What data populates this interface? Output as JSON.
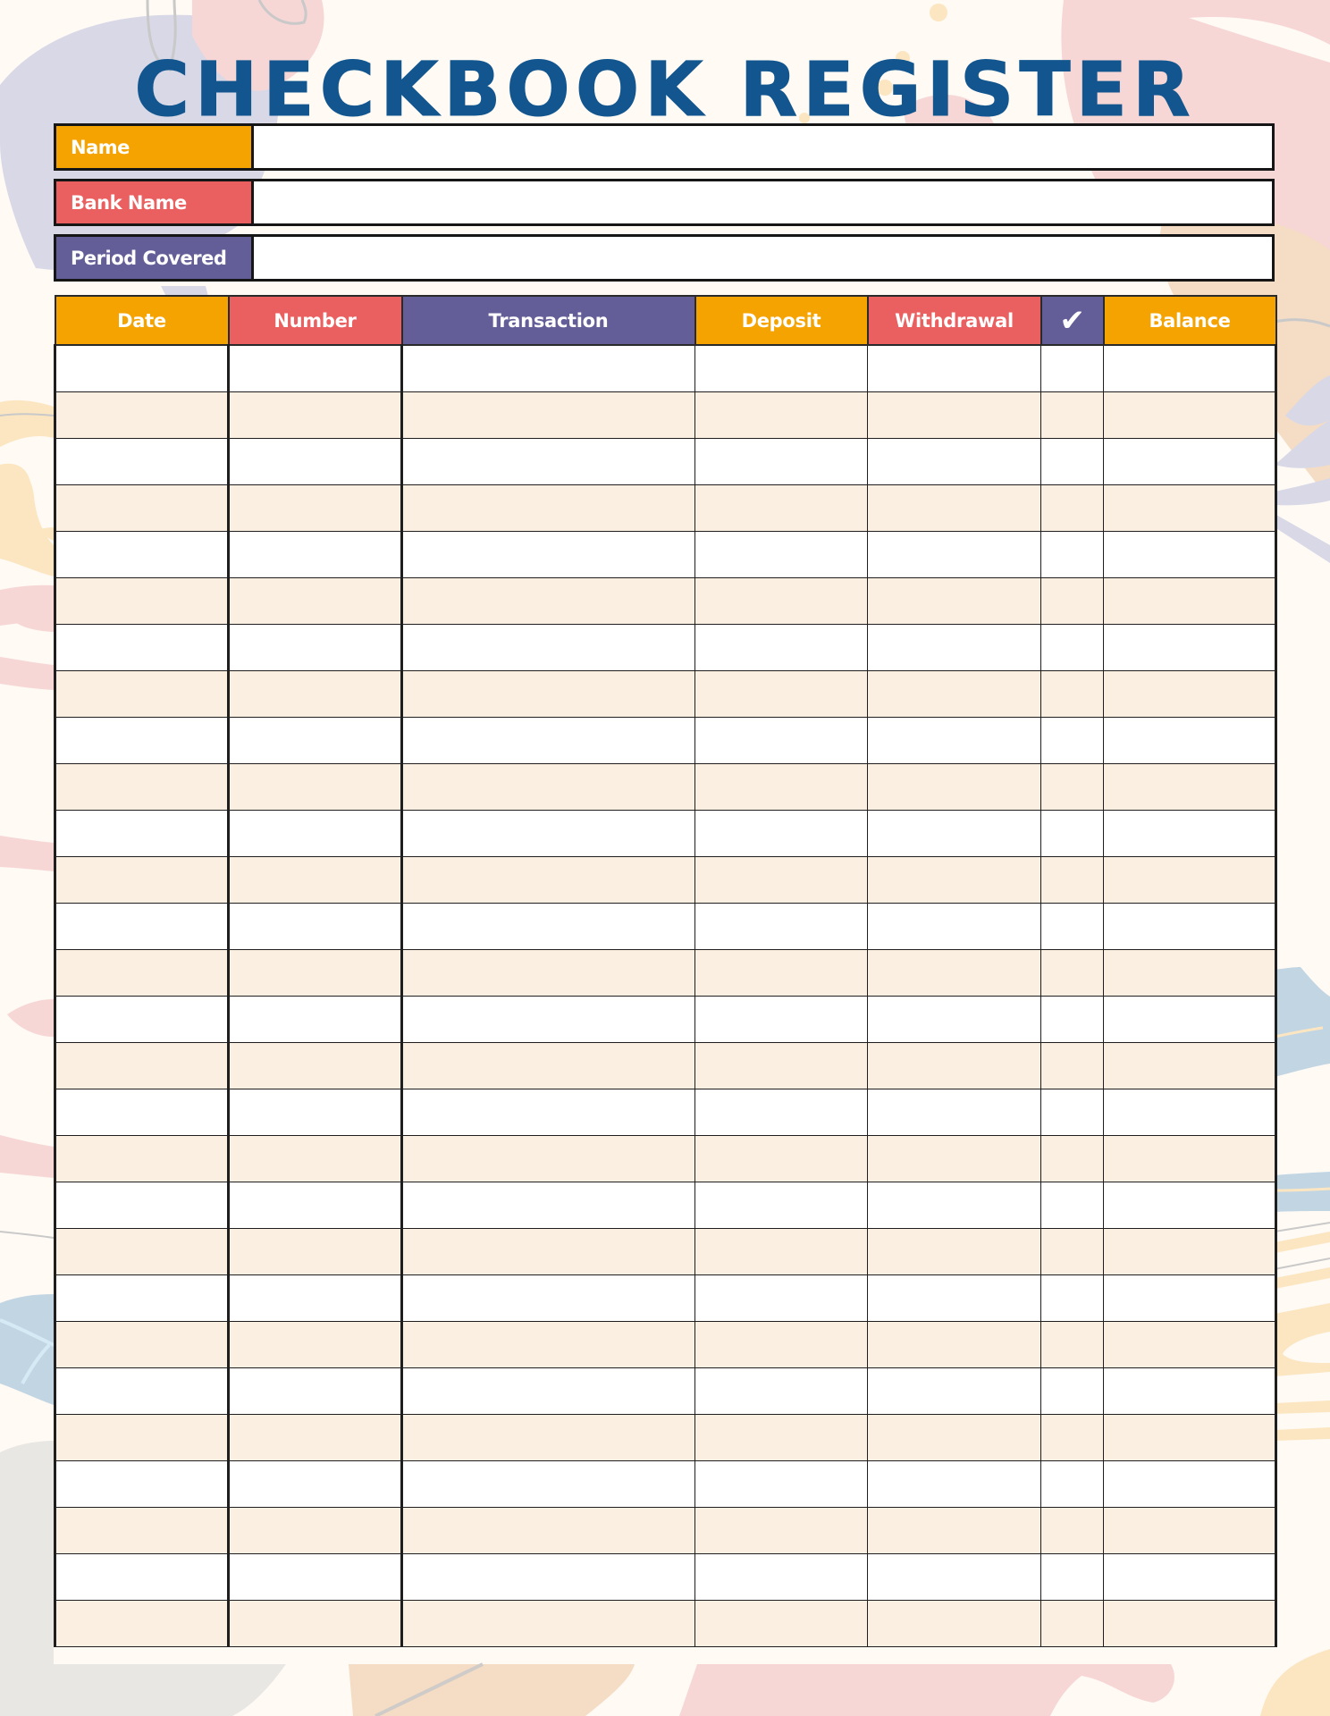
{
  "title": "CHECKBOOK REGISTER",
  "colors": {
    "orange": "#F4A300",
    "coral": "#EA5F5F",
    "purple": "#635E98",
    "title_blue": "#13568F",
    "row_alt": "#FBEFE2",
    "row_plain": "#FFFFFF",
    "page_bg": "#FFFAF4"
  },
  "info_fields": [
    {
      "label": "Name",
      "value": "",
      "color": "#F4A300"
    },
    {
      "label": "Bank Name",
      "value": "",
      "color": "#EA5F5F"
    },
    {
      "label": "Period Covered",
      "value": "",
      "color": "#635E98"
    }
  ],
  "register": {
    "columns": [
      {
        "label": "Date",
        "color": "#F4A300"
      },
      {
        "label": "Number",
        "color": "#EA5F5F"
      },
      {
        "label": "Transaction",
        "color": "#635E98"
      },
      {
        "label": "Deposit",
        "color": "#F4A300"
      },
      {
        "label": "Withdrawal",
        "color": "#EA5F5F"
      },
      {
        "label": "✔",
        "icon": "checkmark-icon",
        "color": "#635E98"
      },
      {
        "label": "Balance",
        "color": "#F4A300"
      }
    ],
    "row_count": 28,
    "rows": []
  }
}
